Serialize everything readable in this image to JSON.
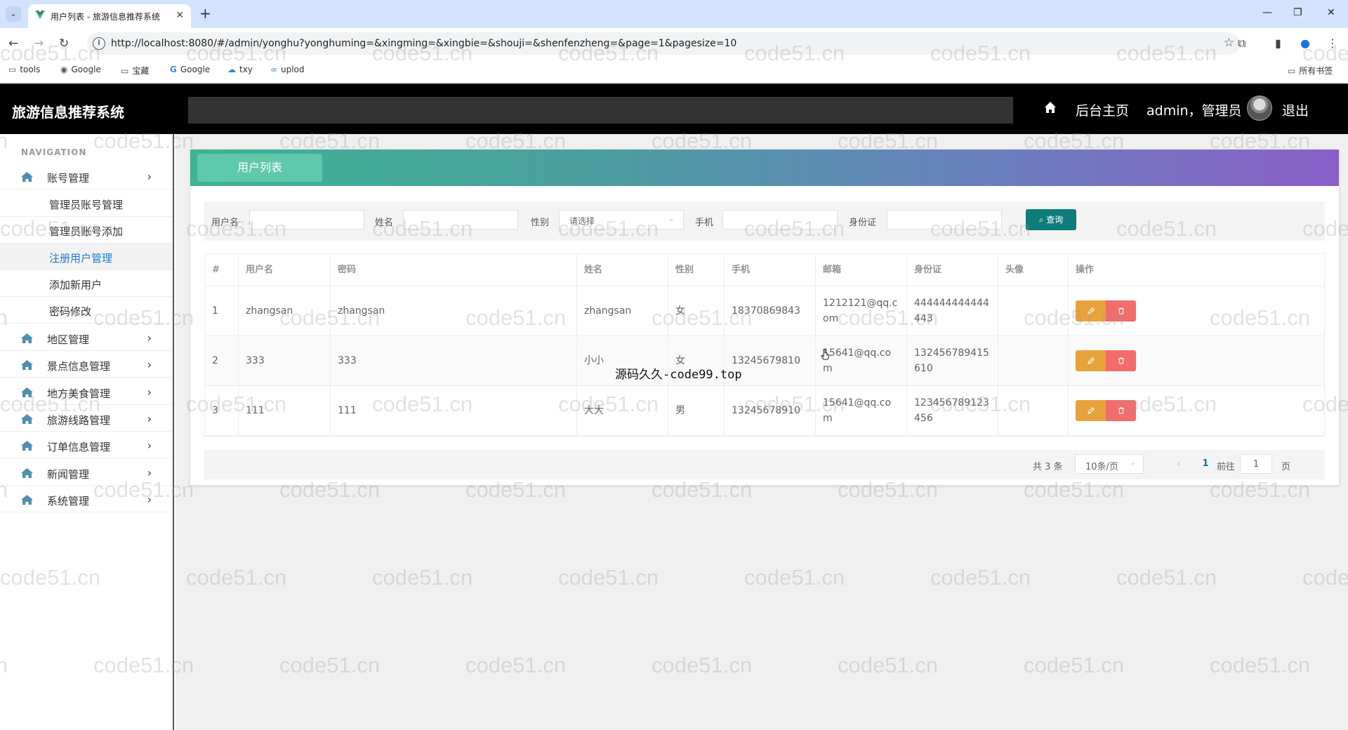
{
  "browser": {
    "tab_title": "用户列表 - 旅游信息推荐系统",
    "url": "http://localhost:8080/#/admin/yonghu?yonghuming=&xingming=&xingbie=&shouji=&shenfenzheng=&page=1&pagesize=10",
    "bookmarks": [
      "tools",
      "Google",
      "宝藏",
      "Google",
      "txy",
      "uplod"
    ],
    "all_bookmarks": "所有书签"
  },
  "header": {
    "app_title": "旅游信息推荐系统",
    "home_link": "后台主页",
    "user_label": "admin，管理员",
    "logout": "退出"
  },
  "sidebar": {
    "caption": "NAVIGATION",
    "items": [
      {
        "label": "账号管理"
      },
      {
        "label": "地区管理"
      },
      {
        "label": "景点信息管理"
      },
      {
        "label": "地方美食管理"
      },
      {
        "label": "旅游线路管理"
      },
      {
        "label": "订单信息管理"
      },
      {
        "label": "新闻管理"
      },
      {
        "label": "系统管理"
      }
    ],
    "subitems": [
      {
        "label": "管理员账号管理"
      },
      {
        "label": "管理员账号添加"
      },
      {
        "label": "注册用户管理"
      },
      {
        "label": "添加新用户"
      },
      {
        "label": "密码修改"
      }
    ]
  },
  "main": {
    "panel_title": "用户列表",
    "search": {
      "username_label": "用户名",
      "username_value": "",
      "name_label": "姓名",
      "name_value": "",
      "gender_label": "性别",
      "gender_placeholder": "请选择",
      "phone_label": "手机",
      "phone_value": "",
      "idcard_label": "身份证",
      "idcard_value": "",
      "query_button": "查询"
    },
    "table": {
      "headers": [
        "#",
        "用户名",
        "密码",
        "姓名",
        "性别",
        "手机",
        "邮箱",
        "身份证",
        "头像",
        "操作"
      ],
      "rows": [
        {
          "index": "1",
          "username": "zhangsan",
          "password": "zhangsan",
          "name": "zhangsan",
          "gender": "女",
          "phone": "18370869843",
          "email": "1212121@qq.com",
          "idcard": "444444444444443",
          "avatar": ""
        },
        {
          "index": "2",
          "username": "333",
          "password": "333",
          "name": "小小",
          "gender": "女",
          "phone": "13245679810",
          "email": "15641@qq.com",
          "idcard": "132456789415610",
          "avatar": ""
        },
        {
          "index": "3",
          "username": "111",
          "password": "111",
          "name": "大大",
          "gender": "男",
          "phone": "13245678910",
          "email": "15641@qq.com",
          "idcard": "123456789123456",
          "avatar": ""
        }
      ]
    },
    "pagination": {
      "total": "共 3 条",
      "page_size": "10条/页",
      "current_page": "1",
      "goto_label": "前往",
      "goto_value": "1",
      "page_suffix": "页"
    }
  },
  "overlay_caption": "源码久久-code99.top",
  "watermark": "code51.cn",
  "colors": {
    "header_bg": "#000000",
    "query_button": "#0f7c7c",
    "edit_button": "#e8a23c",
    "delete_button": "#f36c6c",
    "active_menu": "#1b7bd6"
  }
}
